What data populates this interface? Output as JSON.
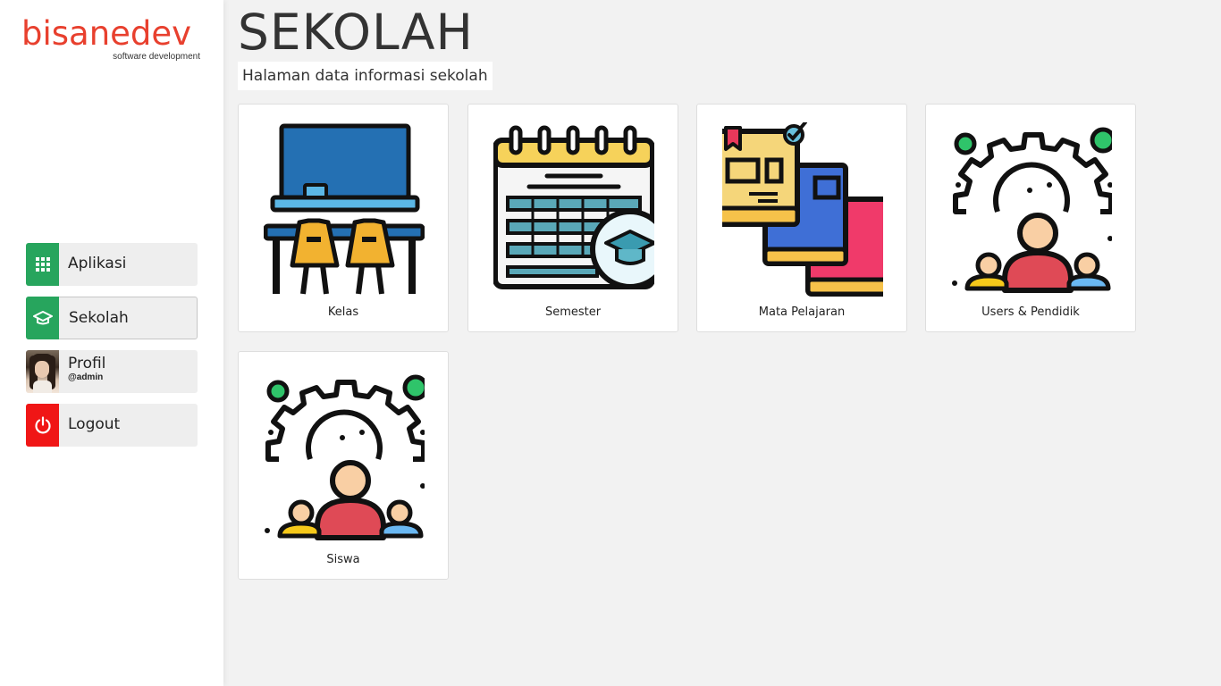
{
  "brand": {
    "name": "bisanedev",
    "tagline": "software development",
    "color": "#e8402e"
  },
  "sidebar": {
    "items": [
      {
        "label": "Aplikasi",
        "icon": "grid-icon",
        "icon_bg": "#27a55d"
      },
      {
        "label": "Sekolah",
        "icon": "graduation-cap-icon",
        "icon_bg": "#27a55d",
        "active": true
      },
      {
        "label": "Profil",
        "sub": "@admin",
        "icon": "avatar"
      },
      {
        "label": "Logout",
        "icon": "power-icon",
        "icon_bg": "#f01616"
      }
    ]
  },
  "page": {
    "title": "SEKOLAH",
    "subtitle": "Halaman data informasi sekolah"
  },
  "cards": [
    {
      "label": "Kelas",
      "icon": "classroom-icon"
    },
    {
      "label": "Semester",
      "icon": "calendar-icon"
    },
    {
      "label": "Mata Pelajaran",
      "icon": "books-icon"
    },
    {
      "label": "Users & Pendidik",
      "icon": "users-gear-icon"
    },
    {
      "label": "Siswa",
      "icon": "students-gear-icon"
    }
  ]
}
